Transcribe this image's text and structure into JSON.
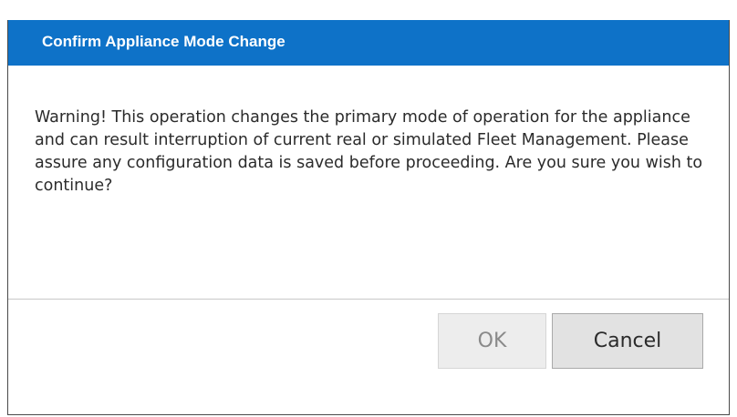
{
  "dialog": {
    "title": "Confirm Appliance Mode Change",
    "message": "Warning! This operation changes the primary mode of operation for the appliance and can result interruption of current real or simulated Fleet Management. Please assure any configuration data is saved before proceeding. Are you sure you wish to continue?",
    "ok_label": "OK",
    "cancel_label": "Cancel"
  },
  "colors": {
    "titlebar": "#0e72c8",
    "title_text": "#ffffff",
    "ok_disabled_text": "#8a8a8a"
  }
}
